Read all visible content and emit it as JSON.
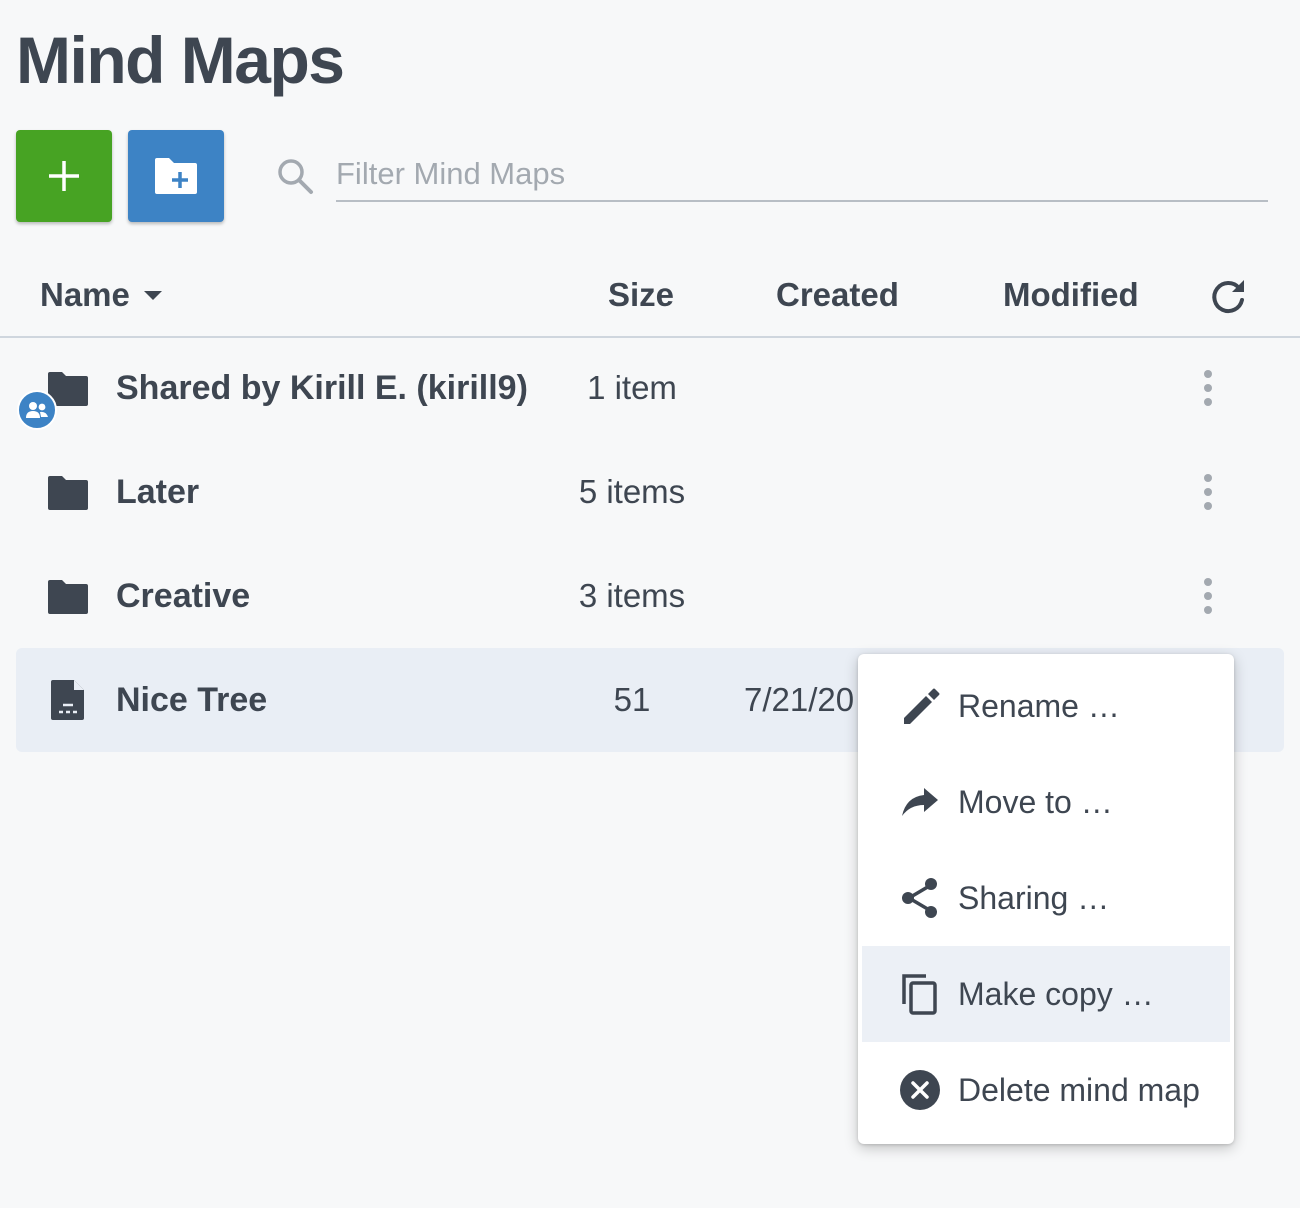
{
  "page": {
    "title": "Mind Maps"
  },
  "toolbar": {
    "new_map_icon": "plus-icon",
    "new_folder_icon": "folder-plus-icon",
    "search_icon": "search-icon",
    "search_placeholder": "Filter Mind Maps",
    "search_value": ""
  },
  "colors": {
    "new_button": "#47a323",
    "folder_button": "#3d83c5",
    "selected_row": "#e9eef5",
    "text": "#3e4651"
  },
  "table": {
    "columns": {
      "name": "Name",
      "size": "Size",
      "created": "Created",
      "modified": "Modified"
    },
    "sort": {
      "column": "Name",
      "direction": "descending-caret"
    },
    "rows": [
      {
        "type": "shared-folder",
        "name": "Shared by Kirill E. (kirill9)",
        "size": "1 item",
        "created": "",
        "modified": ""
      },
      {
        "type": "folder",
        "name": "Later",
        "size": "5 items",
        "created": "",
        "modified": ""
      },
      {
        "type": "folder",
        "name": "Creative",
        "size": "3 items",
        "created": "",
        "modified": ""
      },
      {
        "type": "document",
        "name": "Nice Tree",
        "size": "51",
        "created": "7/21/20",
        "modified": "",
        "selected": true
      }
    ]
  },
  "context_menu": {
    "items": [
      {
        "label": "Rename …",
        "icon": "pencil-icon"
      },
      {
        "label": "Move to …",
        "icon": "forward-arrow-icon"
      },
      {
        "label": "Sharing …",
        "icon": "share-icon"
      },
      {
        "label": "Make copy …",
        "icon": "copy-icon",
        "hovered": true
      },
      {
        "label": "Delete mind map",
        "icon": "delete-circle-icon"
      }
    ]
  }
}
